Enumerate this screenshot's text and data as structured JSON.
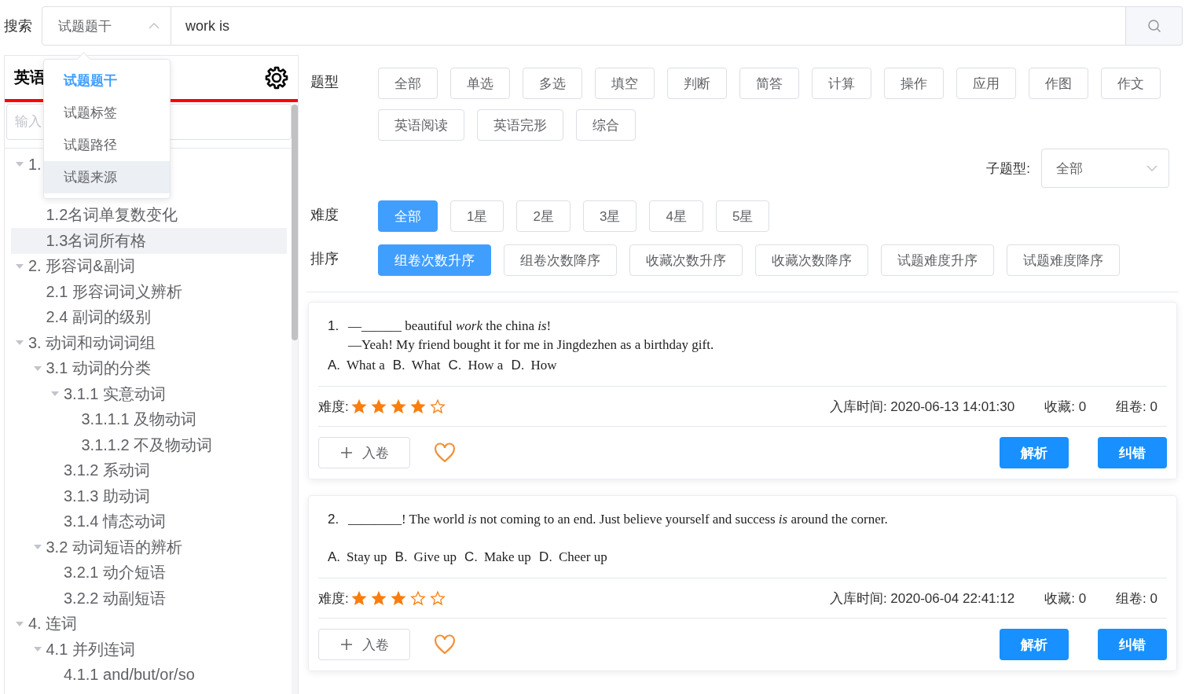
{
  "search": {
    "label": "搜索",
    "field_select": {
      "value": "试题题干",
      "open": true
    },
    "query": "work is"
  },
  "field_menu": [
    {
      "label": "试题题干",
      "selected": true,
      "highlighted": false
    },
    {
      "label": "试题标签",
      "selected": false,
      "highlighted": false
    },
    {
      "label": "试题路径",
      "selected": false,
      "highlighted": false
    },
    {
      "label": "试题来源",
      "selected": false,
      "highlighted": true
    }
  ],
  "sidebar": {
    "title": "英语",
    "filter_placeholder": "输入",
    "tree": [
      {
        "label": "1.",
        "expanded": true,
        "selected": false,
        "children": [
          {
            "label": "1.2名词单复数变化",
            "selected": false
          },
          {
            "label": "1.3名词所有格",
            "selected": true
          }
        ]
      },
      {
        "label": "2. 形容词&副词",
        "expanded": true,
        "selected": false,
        "children": [
          {
            "label": "2.1 形容词词义辨析",
            "selected": false
          },
          {
            "label": "2.4 副词的级别",
            "selected": false
          }
        ]
      },
      {
        "label": "3. 动词和动词词组",
        "expanded": true,
        "selected": false,
        "children": [
          {
            "label": "3.1 动词的分类",
            "expanded": true,
            "selected": false,
            "children": [
              {
                "label": "3.1.1 实意动词",
                "expanded": true,
                "selected": false,
                "children": [
                  {
                    "label": "3.1.1.1 及物动词",
                    "selected": false
                  },
                  {
                    "label": "3.1.1.2 不及物动词",
                    "selected": false
                  }
                ]
              },
              {
                "label": "3.1.2 系动词",
                "selected": false
              },
              {
                "label": "3.1.3 助动词",
                "selected": false
              },
              {
                "label": "3.1.4 情态动词",
                "selected": false
              }
            ]
          },
          {
            "label": "3.2 动词短语的辨析",
            "expanded": true,
            "selected": false,
            "children": [
              {
                "label": "3.2.1 动介短语",
                "selected": false
              },
              {
                "label": "3.2.2 动副短语",
                "selected": false
              }
            ]
          }
        ]
      },
      {
        "label": "4. 连词",
        "expanded": true,
        "selected": false,
        "children": [
          {
            "label": "4.1 并列连词",
            "expanded": true,
            "selected": false,
            "children": [
              {
                "label": "4.1.1 and/but/or/so",
                "selected": false
              }
            ]
          }
        ]
      }
    ]
  },
  "filters": {
    "type": {
      "label": "题型",
      "options": [
        {
          "label": "全部",
          "selected": false
        },
        {
          "label": "单选",
          "selected": false
        },
        {
          "label": "多选",
          "selected": false
        },
        {
          "label": "填空",
          "selected": false
        },
        {
          "label": "判断",
          "selected": false
        },
        {
          "label": "简答",
          "selected": false
        },
        {
          "label": "计算",
          "selected": false
        },
        {
          "label": "操作",
          "selected": false
        },
        {
          "label": "应用",
          "selected": false
        },
        {
          "label": "作图",
          "selected": false
        },
        {
          "label": "作文",
          "selected": false
        },
        {
          "label": "英语阅读",
          "selected": false
        },
        {
          "label": "英语完形",
          "selected": false
        },
        {
          "label": "综合",
          "selected": false
        }
      ]
    },
    "subtype": {
      "label": "子题型:",
      "value": "全部"
    },
    "difficulty": {
      "label": "难度",
      "options": [
        {
          "label": "全部",
          "selected": true
        },
        {
          "label": "1星",
          "selected": false
        },
        {
          "label": "2星",
          "selected": false
        },
        {
          "label": "3星",
          "selected": false
        },
        {
          "label": "4星",
          "selected": false
        },
        {
          "label": "5星",
          "selected": false
        }
      ]
    },
    "sort": {
      "label": "排序",
      "options": [
        {
          "label": "组卷次数升序",
          "selected": true
        },
        {
          "label": "组卷次数降序",
          "selected": false
        },
        {
          "label": "收藏次数升序",
          "selected": false
        },
        {
          "label": "收藏次数降序",
          "selected": false
        },
        {
          "label": "试题难度升序",
          "selected": false
        },
        {
          "label": "试题难度降序",
          "selected": false
        }
      ]
    }
  },
  "questions": [
    {
      "number": "1.",
      "stem": [
        "—______ beautiful *work* the china *is*!",
        "—Yeah! My friend bought it for me in Jingdezhen as a birthday gift."
      ],
      "options": [
        {
          "letter": "A.",
          "text": "What a"
        },
        {
          "letter": "B.",
          "text": "What"
        },
        {
          "letter": "C.",
          "text": "How a"
        },
        {
          "letter": "D.",
          "text": "How"
        }
      ],
      "difficulty_label": "难度:",
      "stars": 4,
      "added": "入库时间: 2020-06-13 14:01:30",
      "favorites": "收藏: 0",
      "used": "组卷: 0",
      "add_button": "入卷",
      "analysis_button": "解析",
      "report_button": "纠错"
    },
    {
      "number": "2.",
      "stem": [
        "________! The world *is* not coming to an end. Just believe yourself and success *is* around the corner."
      ],
      "options": [
        {
          "letter": "A.",
          "text": "Stay up"
        },
        {
          "letter": "B.",
          "text": "Give up"
        },
        {
          "letter": "C.",
          "text": "Make up"
        },
        {
          "letter": "D.",
          "text": "Cheer up"
        }
      ],
      "difficulty_label": "难度:",
      "stars": 3,
      "added": "入库时间: 2020-06-04 22:41:12",
      "favorites": "收藏: 0",
      "used": "组卷: 0",
      "add_button": "入卷",
      "analysis_button": "解析",
      "report_button": "纠错"
    }
  ]
}
